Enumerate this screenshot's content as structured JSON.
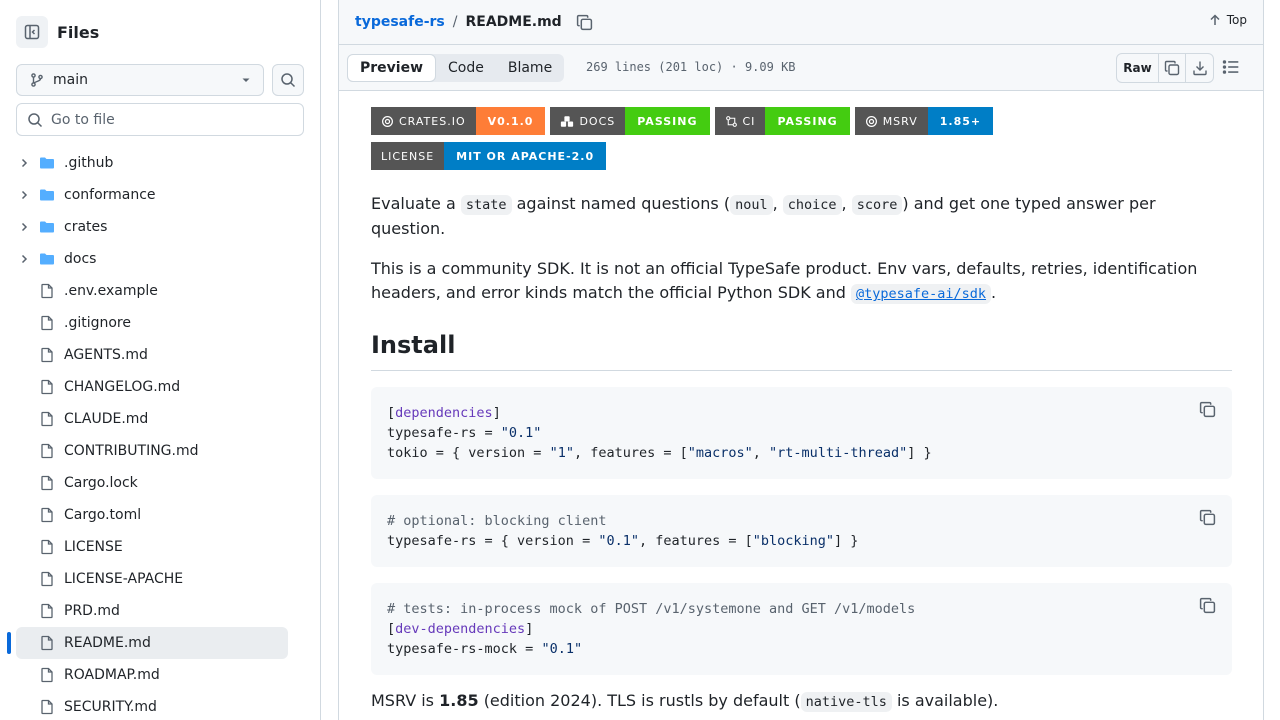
{
  "sidebar": {
    "title": "Files",
    "branch": "main",
    "search_placeholder": "Go to file",
    "items": [
      {
        "label": ".github",
        "type": "folder"
      },
      {
        "label": "conformance",
        "type": "folder"
      },
      {
        "label": "crates",
        "type": "folder"
      },
      {
        "label": "docs",
        "type": "folder"
      },
      {
        "label": ".env.example",
        "type": "file"
      },
      {
        "label": ".gitignore",
        "type": "file"
      },
      {
        "label": "AGENTS.md",
        "type": "file"
      },
      {
        "label": "CHANGELOG.md",
        "type": "file"
      },
      {
        "label": "CLAUDE.md",
        "type": "file"
      },
      {
        "label": "CONTRIBUTING.md",
        "type": "file"
      },
      {
        "label": "Cargo.lock",
        "type": "file"
      },
      {
        "label": "Cargo.toml",
        "type": "file"
      },
      {
        "label": "LICENSE",
        "type": "file"
      },
      {
        "label": "LICENSE-APACHE",
        "type": "file"
      },
      {
        "label": "PRD.md",
        "type": "file"
      },
      {
        "label": "README.md",
        "type": "file",
        "selected": true
      },
      {
        "label": "ROADMAP.md",
        "type": "file"
      },
      {
        "label": "SECURITY.md",
        "type": "file"
      }
    ]
  },
  "header": {
    "repo": "typesafe-rs",
    "separator": "/",
    "file": "README.md",
    "top_label": "Top"
  },
  "filebar": {
    "tabs": [
      "Preview",
      "Code",
      "Blame"
    ],
    "active_tab": "Preview",
    "info": "269 lines (201 loc) · 9.09 KB",
    "raw_label": "Raw"
  },
  "readme": {
    "badges": [
      {
        "label": "CRATES.IO",
        "value": "V0.1.0",
        "color": "#fe7d37",
        "icon": "rust-icon"
      },
      {
        "label": "DOCS",
        "value": "PASSING",
        "color": "#4c1",
        "icon": "docs-rs-icon"
      },
      {
        "label": "CI",
        "value": "PASSING",
        "color": "#4c1",
        "icon": "github-actions-icon"
      },
      {
        "label": "MSRV",
        "value": "1.85+",
        "color": "#007ec6",
        "icon": "rust-icon"
      },
      {
        "label": "LICENSE",
        "value": "MIT OR APACHE-2.0",
        "color": "#007ec6",
        "icon": ""
      }
    ],
    "p1": {
      "a": "Evaluate a",
      "c1": "state",
      "b": "against named questions (",
      "c2": "noul",
      "sep1": ",",
      "c3": "choice",
      "sep2": ",",
      "c4": "score",
      "d": ") and get one typed answer per question."
    },
    "p2": {
      "text": "This is a community SDK. It is not an official TypeSafe product. Env vars, defaults, retries, identification headers, and error kinds match the official Python SDK and",
      "link": "@typesafe-ai/sdk",
      "end": "."
    },
    "install_heading": "Install",
    "code1": {
      "section": "dependencies",
      "l2_key": "typesafe-rs = ",
      "l2_val": "\"0.1\"",
      "l3_a": "tokio = { version = ",
      "l3_v": "\"1\"",
      "l3_b": ", features = [",
      "l3_f1": "\"macros\"",
      "l3_c": ", ",
      "l3_f2": "\"rt-multi-thread\"",
      "l3_d": "] }"
    },
    "code2": {
      "comment": "# optional: blocking client",
      "l2_a": "typesafe-rs = { version = ",
      "l2_v": "\"0.1\"",
      "l2_b": ", features = [",
      "l2_f": "\"blocking\"",
      "l2_c": "] }"
    },
    "code3": {
      "comment": "# tests: in-process mock of POST /v1/systemone and GET /v1/models",
      "section": "dev-dependencies",
      "l3_key": "typesafe-rs-mock = ",
      "l3_val": "\"0.1\""
    },
    "last": {
      "a": "MSRV is",
      "b": "1.85",
      "c": "(edition 2024). TLS is rustls by default (",
      "code": "native-tls",
      "d": "is available)."
    }
  }
}
